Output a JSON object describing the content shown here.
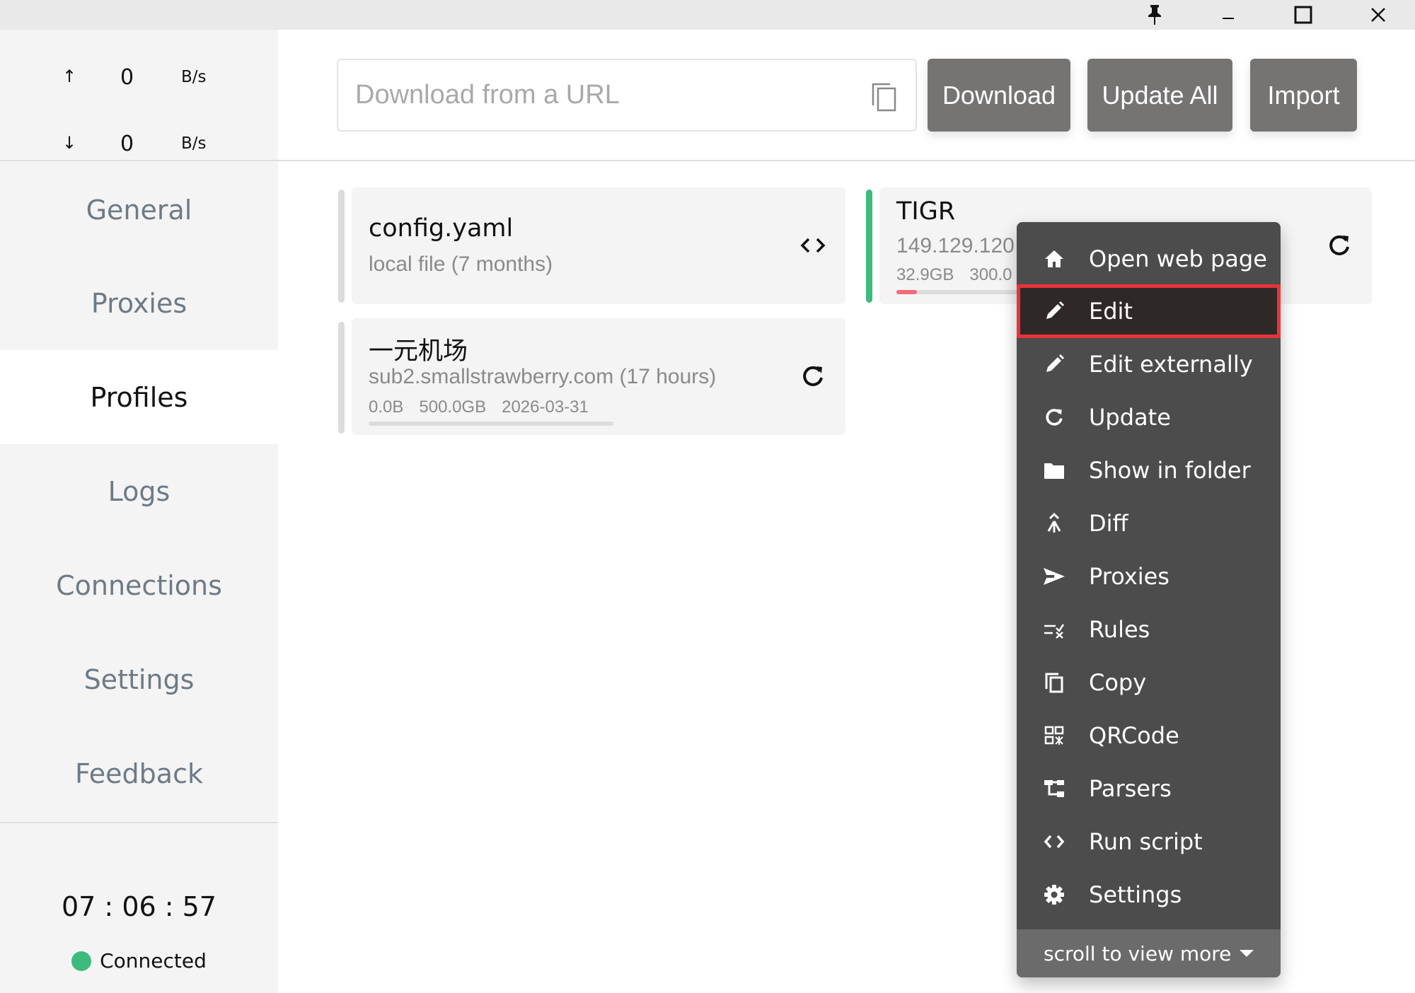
{
  "titlebar": {
    "buttons": [
      "pin",
      "minimize",
      "maximize",
      "close"
    ]
  },
  "traffic": {
    "upload": {
      "arrow": "↑",
      "value": "0",
      "unit": "B/s"
    },
    "download": {
      "arrow": "↓",
      "value": "0",
      "unit": "B/s"
    }
  },
  "sidebar": {
    "items": [
      {
        "label": "General"
      },
      {
        "label": "Proxies"
      },
      {
        "label": "Profiles",
        "active": true
      },
      {
        "label": "Logs"
      },
      {
        "label": "Connections"
      },
      {
        "label": "Settings"
      },
      {
        "label": "Feedback"
      }
    ],
    "clock": "07 : 06 : 57",
    "status": {
      "label": "Connected",
      "color": "#3dba7e"
    }
  },
  "toolbar": {
    "url_placeholder": "Download from a URL",
    "url_value": "",
    "download_label": "Download",
    "update_all_label": "Update All",
    "import_label": "Import"
  },
  "profiles": [
    {
      "name": "config.yaml",
      "subtitle": "local file (7 months)",
      "action_icon": "code-icon",
      "selected": false
    },
    {
      "name": "TIGR",
      "subtitle": "149.129.120",
      "used": "32.9GB",
      "total": "300.0",
      "usage_fraction": 0.11,
      "action_icon": "refresh-icon",
      "selected": true
    },
    {
      "name": "一元机场",
      "subtitle": "sub2.smallstrawberry.com (17 hours)",
      "used": "0.0B",
      "total": "500.0GB",
      "expiry": "2026-03-31",
      "usage_fraction": 0.0,
      "action_icon": "refresh-icon",
      "selected": false
    }
  ],
  "context_menu": {
    "items": [
      {
        "label": "Open web page",
        "icon": "home-icon"
      },
      {
        "label": "Edit",
        "icon": "pencil-icon",
        "highlighted": true
      },
      {
        "label": "Edit externally",
        "icon": "pencil-icon"
      },
      {
        "label": "Update",
        "icon": "refresh-icon"
      },
      {
        "label": "Show in folder",
        "icon": "folder-icon"
      },
      {
        "label": "Diff",
        "icon": "merge-icon"
      },
      {
        "label": "Proxies",
        "icon": "send-icon"
      },
      {
        "label": "Rules",
        "icon": "rules-icon"
      },
      {
        "label": "Copy",
        "icon": "copy-icon"
      },
      {
        "label": "QRCode",
        "icon": "qrcode-icon"
      },
      {
        "label": "Parsers",
        "icon": "tree-icon"
      },
      {
        "label": "Run script",
        "icon": "code-icon"
      },
      {
        "label": "Settings",
        "icon": "gear-icon"
      }
    ],
    "footer_label": "scroll to view more"
  },
  "colors": {
    "accent_green": "#3dba7e",
    "usage_red": "#f06b78",
    "highlight_red": "#e8333a",
    "button_gray": "#767473",
    "menu_bg": "#4c4c4c"
  }
}
